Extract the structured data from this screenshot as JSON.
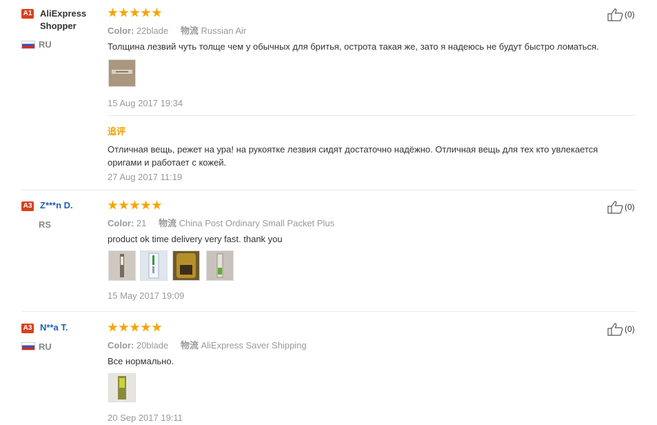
{
  "reviews": [
    {
      "badge": "A1",
      "user": "AliExpress Shopper",
      "country": "RU",
      "color_label": "Color:",
      "color_value": "22blade",
      "shipping_label": "物流",
      "shipping_value": "Russian Air",
      "text": "Толщина лезвий чуть толще чем у обычных для бритья, острота такая же, зато я надеюсь не будут быстро ломаться.",
      "date": "15 Aug 2017 19:34",
      "likes": "(0)",
      "followup_label": "追评",
      "followup_text": "Отличная вещь, режет на ура! на рукоятке лезвия сидят достаточно надёжно. Отличная вещь для тех кто увлекается оригами и работает с кожей.",
      "followup_date": "27 Aug 2017 11:19"
    },
    {
      "badge": "A3",
      "user": "Z***n D.",
      "country": "RS",
      "color_label": "Color:",
      "color_value": "21",
      "shipping_label": "物流",
      "shipping_value": "China Post Ordinary Small Packet Plus",
      "text": "product ok time delivery very fast. thank you",
      "date": "15 May 2017 19:09",
      "likes": "(0)"
    },
    {
      "badge": "A3",
      "user": "N**a T.",
      "country": "RU",
      "color_label": "Color:",
      "color_value": "20blade",
      "shipping_label": "物流",
      "shipping_value": "AliExpress Saver Shipping",
      "text": "Все нормально.",
      "date": "20 Sep 2017 19:11",
      "likes": "(0)"
    }
  ],
  "colors": {
    "star": "#f6a500",
    "badge": "#d8401d",
    "link": "#2060b0",
    "followup": "#f0a000"
  },
  "icons": {
    "like": "thumbs-up-icon",
    "star": "star-icon"
  }
}
